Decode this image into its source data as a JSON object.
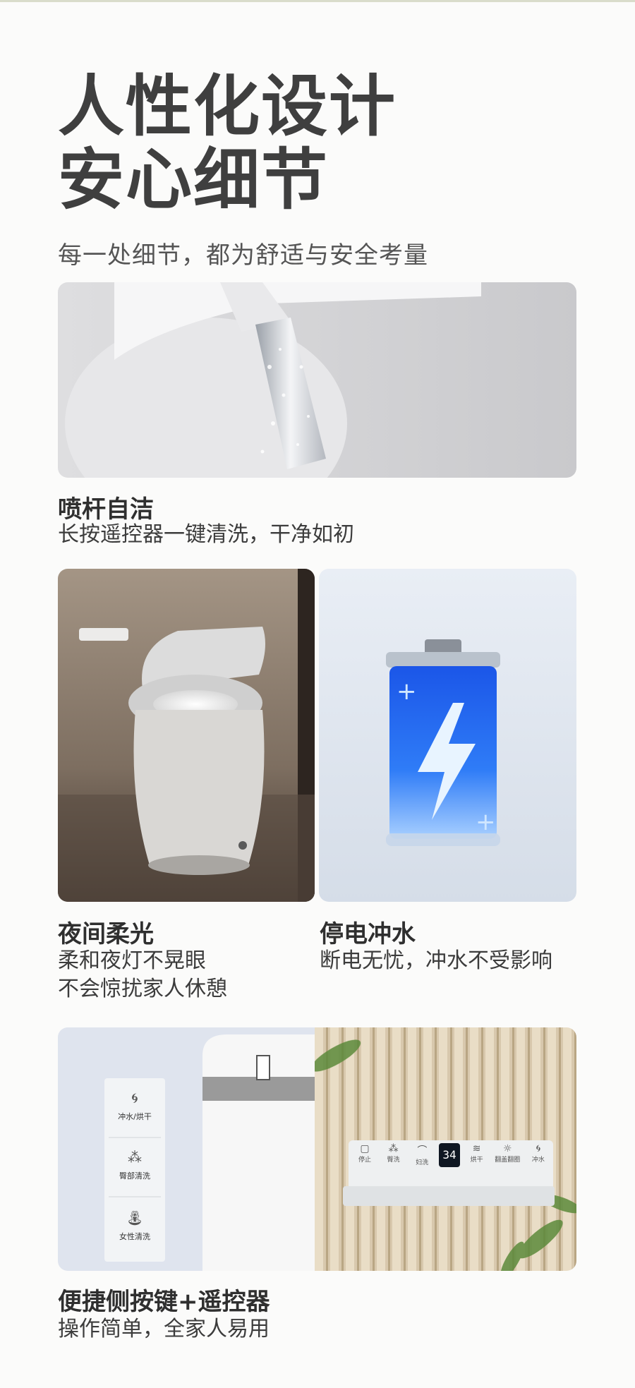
{
  "hero": {
    "title_line1": "人性化设计",
    "title_line2": "安心细节",
    "subtitle": "每一处细节，都为舒适与安全考量"
  },
  "features": [
    {
      "title": "喷杆自洁",
      "desc_lines": [
        "长按遥控器一键清洗，干净如初"
      ]
    },
    {
      "title": "夜间柔光",
      "desc_lines": [
        "柔和夜灯不晃眼",
        "不会惊扰家人休憩"
      ]
    },
    {
      "title": "停电冲水",
      "desc_lines": [
        "断电无忧，冲水不受影响"
      ]
    },
    {
      "title": "便捷侧按键+遥控器",
      "desc_lines": [
        "操作简单，全家人易用"
      ]
    }
  ],
  "side_panel": {
    "buttons": [
      {
        "label": "冲水/烘干",
        "icon": "swirl-icon"
      },
      {
        "label": "臀部清洗",
        "icon": "spray-icon"
      },
      {
        "label": "女性清洗",
        "icon": "bidet-icon"
      }
    ]
  },
  "remote": {
    "display": "34",
    "buttons": [
      "停止",
      "臀洗",
      "妇洗",
      "34",
      "烘干",
      "翻盖翻圈",
      "冲水"
    ]
  },
  "colors": {
    "accent_blue": "#2f6bff",
    "background": "#fbfbfa",
    "text_dark": "#3f3f3f"
  }
}
